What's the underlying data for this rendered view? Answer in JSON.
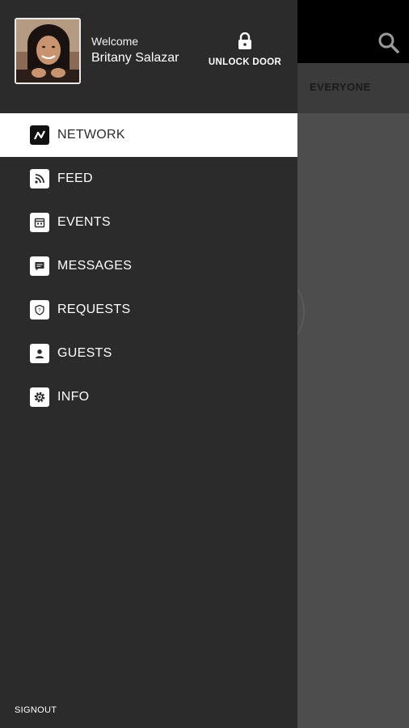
{
  "background": {
    "tab_label": "EVERYONE",
    "search_icon": "search-icon"
  },
  "drawer": {
    "welcome": "Welcome",
    "user_name": "Britany Salazar",
    "unlock_label": "UNLOCK DOOR",
    "signout": "SIGNOUT",
    "items": [
      {
        "label": "NETWORK",
        "icon": "network-icon",
        "active": true
      },
      {
        "label": "FEED",
        "icon": "rss-icon"
      },
      {
        "label": "EVENTS",
        "icon": "calendar-icon"
      },
      {
        "label": "MESSAGES",
        "icon": "chat-icon"
      },
      {
        "label": "REQUESTS",
        "icon": "shield-icon"
      },
      {
        "label": "GUESTS",
        "icon": "person-icon"
      },
      {
        "label": "INFO",
        "icon": "gear-icon"
      }
    ]
  },
  "colors": {
    "drawer_bg": "#2b2b2b",
    "active_bg": "#ffffff",
    "topbar_bg": "#000000",
    "content_bg": "#4d4d4d"
  }
}
